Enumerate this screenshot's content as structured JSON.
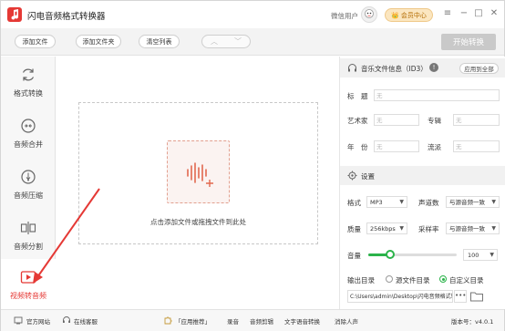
{
  "app": {
    "title": "闪电音频格式转换器",
    "user": "微信用户",
    "member_btn": "会员中心"
  },
  "toolbar": {
    "add_file": "添加文件",
    "add_folder": "添加文件夹",
    "clear_list": "清空列表",
    "start": "开始转换"
  },
  "sidebar": {
    "items": [
      {
        "label": "格式转换",
        "icon": "refresh-icon"
      },
      {
        "label": "音频合并",
        "icon": "merge-icon"
      },
      {
        "label": "音频压缩",
        "icon": "compress-icon"
      },
      {
        "label": "音频分割",
        "icon": "split-icon"
      },
      {
        "label": "视频转音频",
        "icon": "video-icon",
        "active": true
      }
    ]
  },
  "dropzone": {
    "text": "点击添加文件或拖拽文件到此处"
  },
  "id3": {
    "title": "音乐文件信息（ID3）",
    "apply_all": "应用到全部",
    "fields": {
      "title_label": "标　题",
      "title_value": "无",
      "artist_label": "艺术家",
      "artist_value": "无",
      "album_label": "专辑",
      "album_value": "无",
      "year_label": "年　份",
      "year_value": "无",
      "genre_label": "流派",
      "genre_value": "无"
    }
  },
  "settings": {
    "title": "设置",
    "format_label": "格式",
    "format_value": "MP3",
    "channels_label": "声道数",
    "channels_value": "与源音频一致",
    "quality_label": "质量",
    "quality_value": "256kbps",
    "samplerate_label": "采样率",
    "samplerate_value": "与源音频一致",
    "volume_label": "音量",
    "volume_value": "100",
    "volume_level": 0.25,
    "output_label": "输出目录",
    "output_source": "源文件目录",
    "output_custom": "自定义目录",
    "output_selected": "custom",
    "output_path": "C:\\Users\\admin\\Desktop\\闪电音频格式转",
    "browse_label": "•••"
  },
  "bottom": {
    "website": "官方网站",
    "support": "在线客服",
    "recommend": "「应用推荐」",
    "links": [
      "录音",
      "音频剪辑",
      "文字语音转换",
      "消除人声"
    ],
    "version": "版本号：v4.0.1"
  },
  "colors": {
    "accent_red": "#e53935",
    "accent_green": "#2bb34a",
    "member_gold": "#fbe6c0"
  }
}
